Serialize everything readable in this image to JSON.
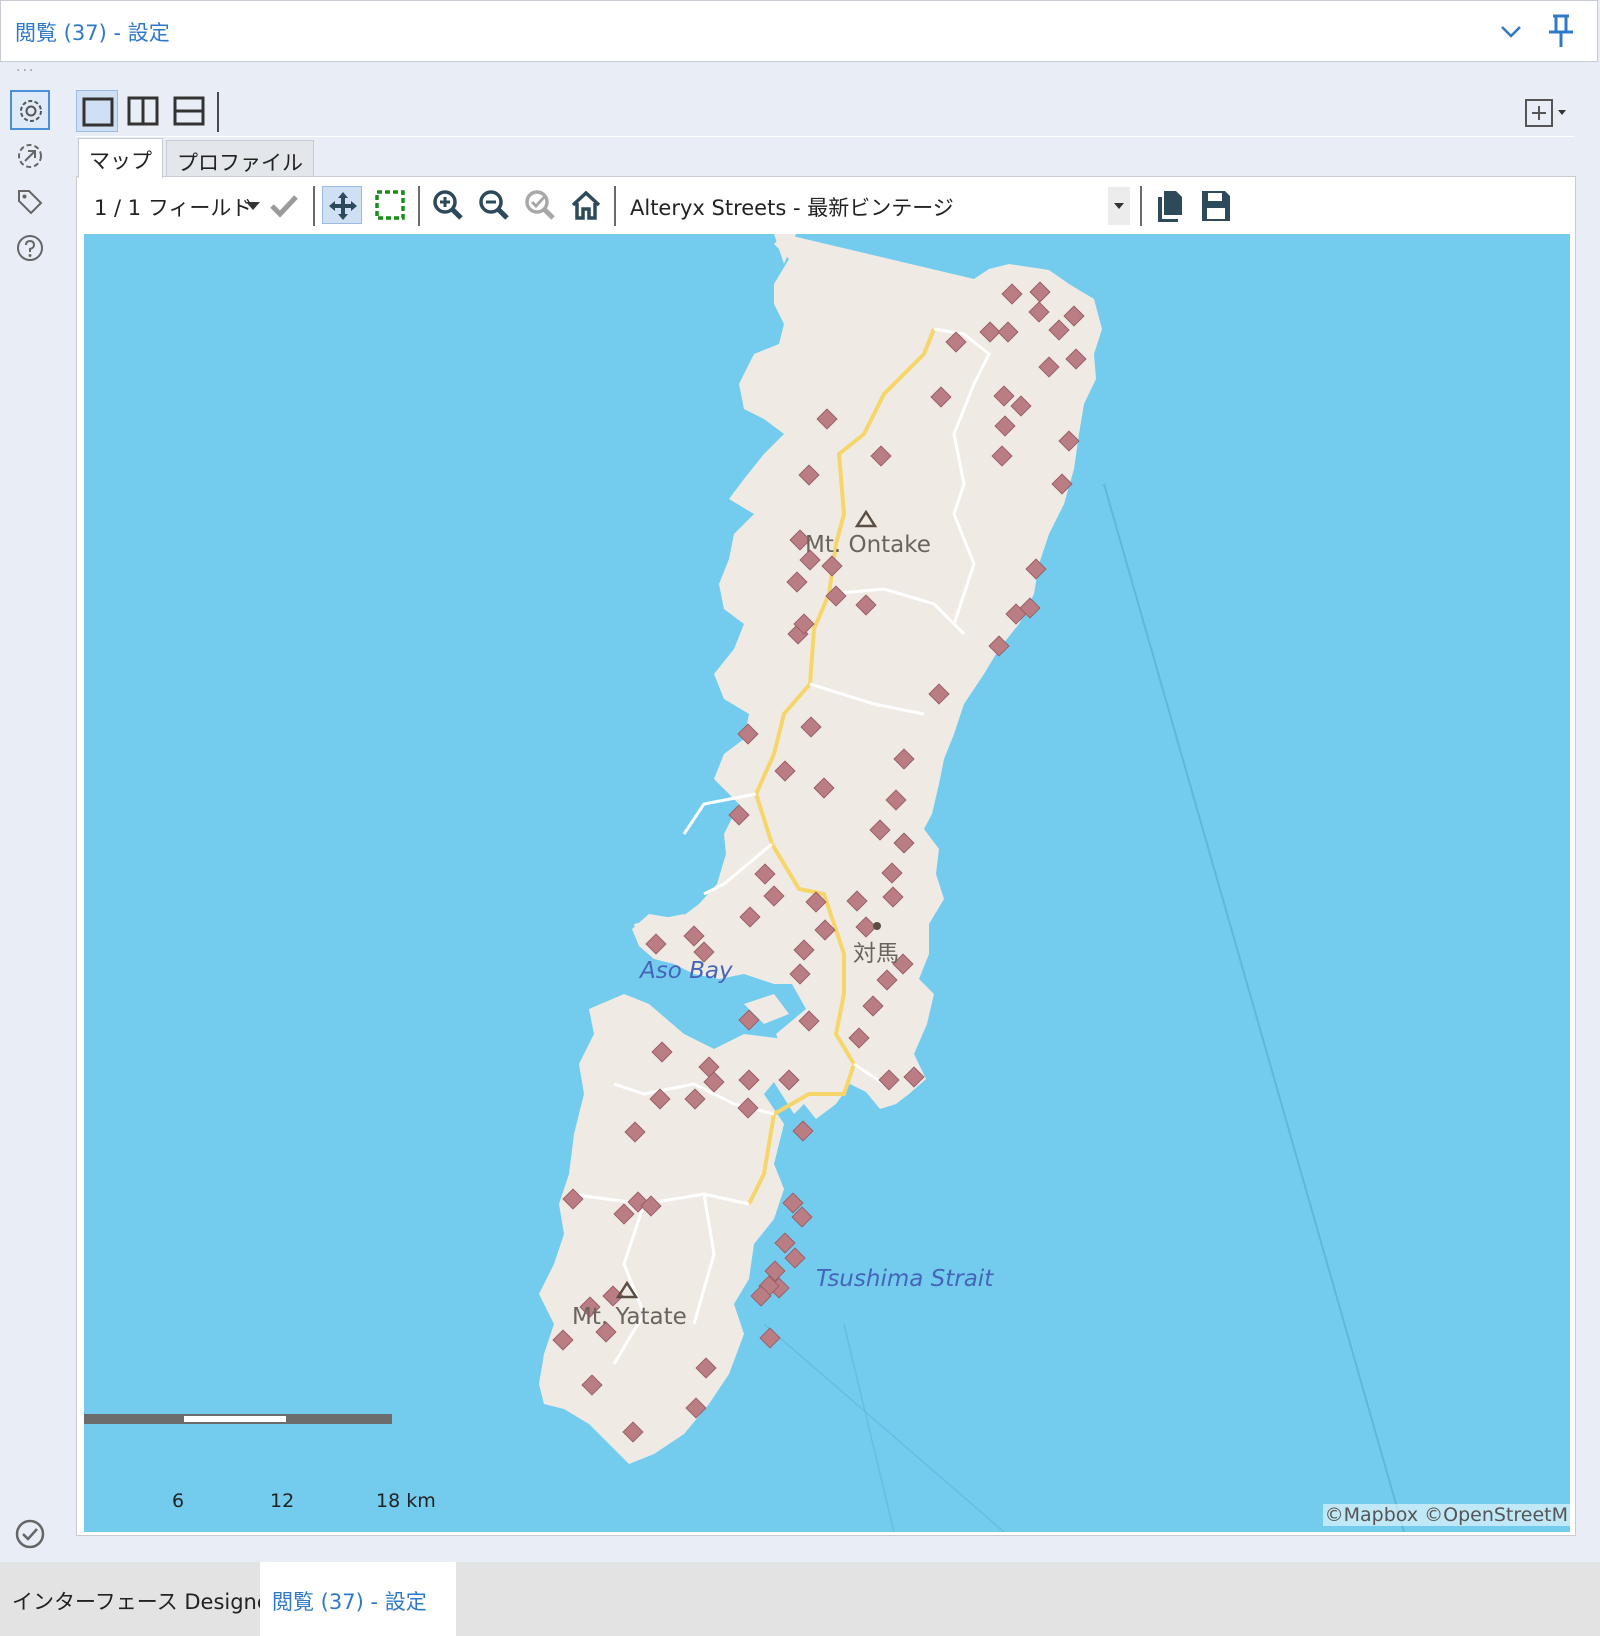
{
  "window": {
    "title": "閲覧 (37) - 設定",
    "icons": [
      "chevron-down-icon",
      "pin-icon"
    ]
  },
  "rail": {
    "items": [
      {
        "name": "configuration",
        "icon": "gear-icon",
        "active": true
      },
      {
        "name": "annotation",
        "icon": "connection-arrow-icon",
        "active": false
      },
      {
        "name": "tag",
        "icon": "tag-icon",
        "active": false
      },
      {
        "name": "help",
        "icon": "question-icon",
        "active": false
      }
    ],
    "footer_icon": "check-circle-icon"
  },
  "layout_buttons": [
    "single-pane-icon",
    "vertical-split-icon",
    "horizontal-split-icon"
  ],
  "tabs": [
    {
      "label": "マップ",
      "active": true
    },
    {
      "label": "プロファイル",
      "active": false
    }
  ],
  "toolbar": {
    "field_selector": "1 / 1 フィールド",
    "basemap": "Alteryx Streets - 最新ビンテージ",
    "tools": [
      "apply-check-icon",
      "pan-icon",
      "select-rectangle-icon",
      "zoom-in-icon",
      "zoom-out-icon",
      "zoom-to-selection-icon",
      "home-icon",
      "copy-icon",
      "save-icon"
    ]
  },
  "map": {
    "labels": {
      "mt_ontake": "Mt. Ontake",
      "tsushima_city": "対馬",
      "aso_bay": "Aso Bay",
      "tsushima_strait": "Tsushima Strait",
      "mt_yatate": "Mt. Yatate"
    },
    "attribution": "©Mapbox ©OpenStreetM",
    "scale": {
      "ticks": [
        "6",
        "12",
        "18 km"
      ]
    },
    "colors": {
      "water": "#73ccee",
      "land": "#efebe4",
      "marker": "#bb7d84",
      "road": "#f6d56b"
    }
  },
  "bottom_tabs": [
    {
      "label": "インターフェース Designer",
      "active": false
    },
    {
      "label": "閲覧 (37) - 設定",
      "active": true
    }
  ]
}
